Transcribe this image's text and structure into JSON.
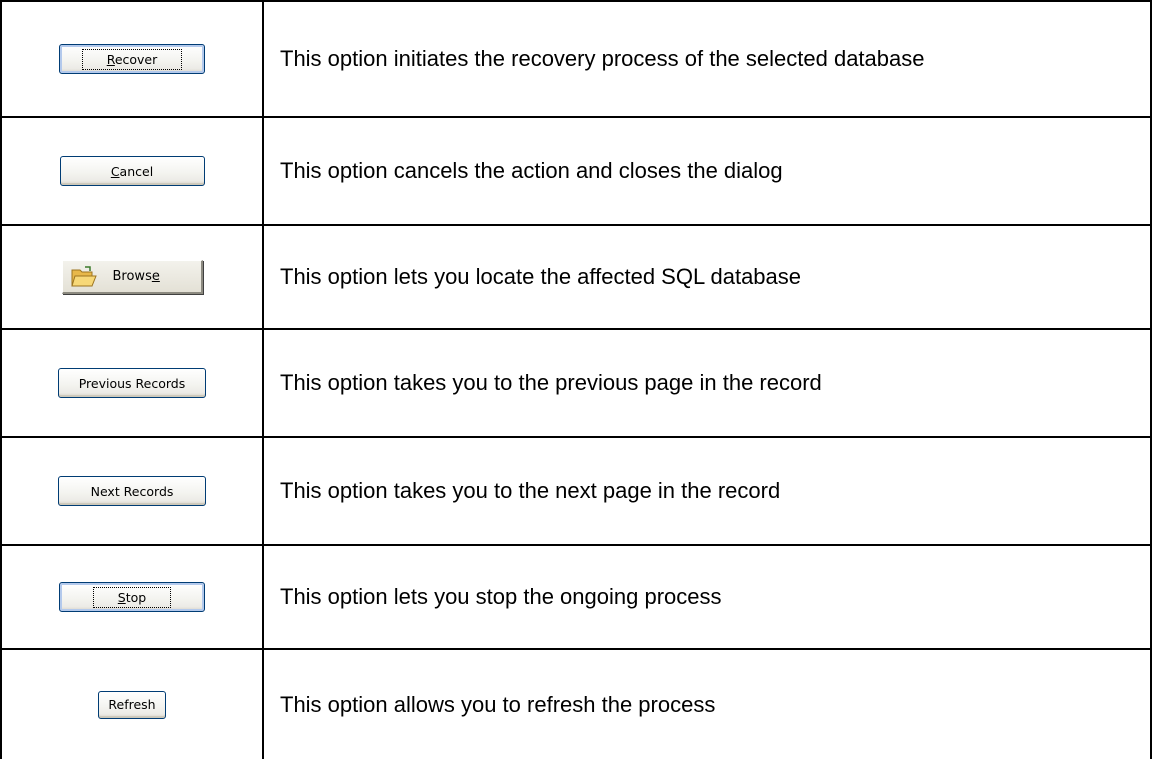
{
  "rows": [
    {
      "button": {
        "pre": "",
        "accel": "R",
        "post": "ecover"
      },
      "description": "This option initiates the recovery process of the selected database"
    },
    {
      "button": {
        "pre": "",
        "accel": "C",
        "post": "ancel"
      },
      "description": "This option cancels the action and closes the dialog"
    },
    {
      "button": {
        "pre": "Brows",
        "accel": "e",
        "post": "",
        "icon": "folder-open-icon"
      },
      "description": "This option lets you locate the affected SQL database"
    },
    {
      "button": {
        "label": "Previous Records"
      },
      "description": "This option takes you to the previous page in the record"
    },
    {
      "button": {
        "label": "Next Records"
      },
      "description": "This option takes you to the next page in the record"
    },
    {
      "button": {
        "pre": "",
        "accel": "S",
        "post": "top"
      },
      "description": "This option lets you stop the ongoing process"
    },
    {
      "button": {
        "label": "Refresh"
      },
      "description": "This option allows you to refresh the process"
    }
  ]
}
